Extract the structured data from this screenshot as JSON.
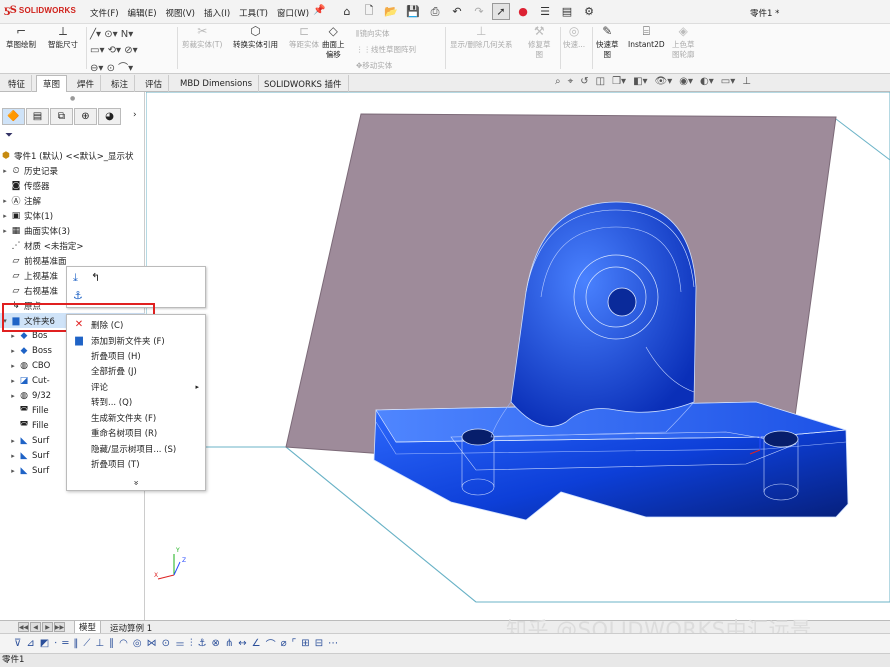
{
  "app": {
    "brand": "SOLIDWORKS",
    "doc_title": "零件1 *"
  },
  "menu": [
    "文件(F)",
    "编辑(E)",
    "视图(V)",
    "插入(I)",
    "工具(T)",
    "窗口(W)"
  ],
  "toolbar_icons": [
    "home-icon",
    "new-file-icon",
    "open-icon",
    "save-icon",
    "print-icon",
    "undo-icon",
    "redo-icon",
    "select-icon",
    "traffic-light-icon",
    "options-list-icon",
    "file-properties-icon",
    "gear-icon"
  ],
  "commands": {
    "sketch": "草图绘制",
    "smart_dim": "智能尺寸",
    "trim": "剪裁实体(T)",
    "convert": "转换实体引用",
    "offset_entities": "等距实体",
    "offset_surface_1": "曲面上",
    "offset_surface_2": "偏移",
    "mirror": "镜向实体",
    "linear_pattern": "线性草图阵列",
    "move": "移动实体",
    "show_hide_relations": "显示/删除几何关系",
    "repair_sketch_1": "修复草",
    "repair_sketch_2": "图",
    "quick_snap": "快速...",
    "rapid_sketch_1": "快速草",
    "rapid_sketch_2": "图",
    "instant2d": "Instant2D",
    "shaded_sketch_1": "上色草",
    "shaded_sketch_2": "图轮廓"
  },
  "tabs": [
    "特征",
    "草图",
    "焊件",
    "标注",
    "评估",
    "MBD Dimensions",
    "SOLIDWORKS 插件"
  ],
  "active_tab": "草图",
  "tree": {
    "root": "零件1 (默认) <<默认>_显示状",
    "items": [
      {
        "label": "历史记录",
        "icon": "history-icon"
      },
      {
        "label": "传感器",
        "icon": "sensor-icon"
      },
      {
        "label": "注解",
        "icon": "annotation-icon"
      },
      {
        "label": "实体(1)",
        "icon": "solid-bodies-icon"
      },
      {
        "label": "曲面实体(3)",
        "icon": "surface-bodies-icon"
      },
      {
        "label": "材质 <未指定>",
        "icon": "material-icon"
      },
      {
        "label": "前视基准面",
        "icon": "plane-icon"
      },
      {
        "label": "上视基准",
        "icon": "plane-icon"
      },
      {
        "label": "右视基准",
        "icon": "plane-icon"
      },
      {
        "label": "原点",
        "icon": "origin-icon"
      },
      {
        "label": "文件夹6",
        "icon": "folder-icon"
      },
      {
        "label": "Bos",
        "icon": "feature-icon"
      },
      {
        "label": "Boss",
        "icon": "feature-icon"
      },
      {
        "label": "CBO",
        "icon": "hole-icon"
      },
      {
        "label": "Cut-",
        "icon": "cut-icon"
      },
      {
        "label": "9/32",
        "icon": "hole-icon"
      },
      {
        "label": "Fille",
        "icon": "fillet-icon"
      },
      {
        "label": "Fille",
        "icon": "fillet-icon"
      },
      {
        "label": "Surf",
        "icon": "surface-icon"
      },
      {
        "label": "Surf",
        "icon": "surface-icon"
      },
      {
        "label": "Surf",
        "icon": "surface-icon"
      }
    ]
  },
  "context_menu": {
    "items": [
      {
        "label": "删除 (C)",
        "icon": "delete-x-icon",
        "submenu": false
      },
      {
        "label": "添加到新文件夹 (F)",
        "icon": "new-folder-icon",
        "submenu": false
      },
      {
        "label": "折叠项目 (H)",
        "icon": "",
        "submenu": false
      },
      {
        "label": "全部折叠 (J)",
        "icon": "",
        "submenu": false
      },
      {
        "label": "评论",
        "icon": "",
        "submenu": true
      },
      {
        "label": "转到... (Q)",
        "icon": "",
        "submenu": false
      },
      {
        "label": "生成新文件夹 (F)",
        "icon": "",
        "submenu": false
      },
      {
        "label": "重命名树项目 (R)",
        "icon": "",
        "submenu": false
      },
      {
        "label": "隐藏/显示树项目... (S)",
        "icon": "",
        "submenu": false
      },
      {
        "label": "折叠项目 (T)",
        "icon": "",
        "submenu": false
      }
    ],
    "more": "»"
  },
  "bottom_tabs": [
    "模型",
    "运动算例 1"
  ],
  "status_text": "零件1",
  "watermark": "知乎 @SOLIDWORKS中汇远景",
  "colors": {
    "accent_red": "#e02020",
    "model_blue": "#1a4fe0",
    "plane_mauve": "#9e8b9a"
  }
}
